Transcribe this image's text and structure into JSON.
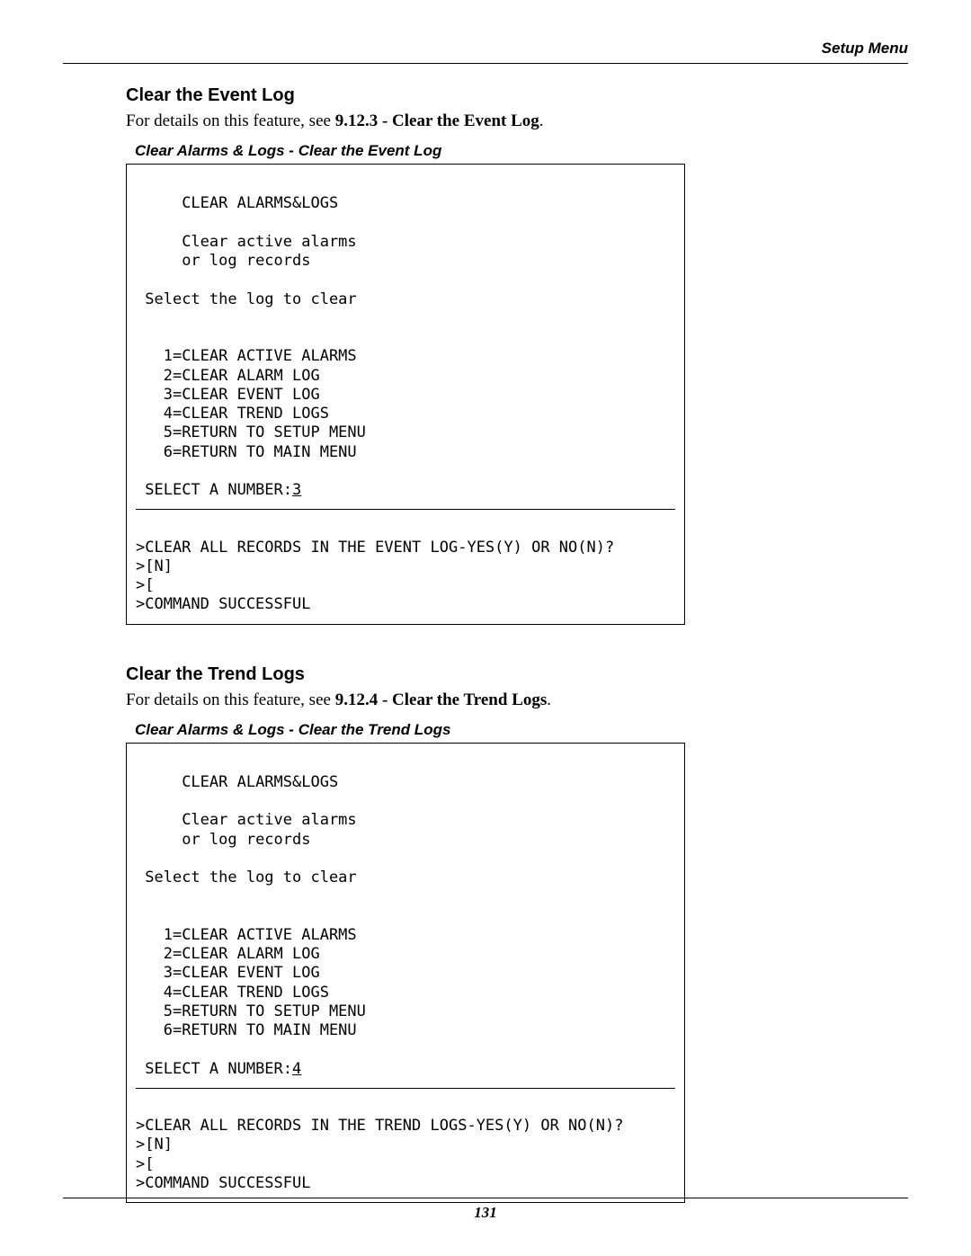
{
  "header": {
    "label": "Setup Menu"
  },
  "page_number": "131",
  "sections": [
    {
      "heading": "Clear the Event Log",
      "lead_pre": "For details on this feature, see ",
      "lead_bold": "9.12.3 - Clear the Event Log",
      "lead_post": ".",
      "caption": "Clear Alarms & Logs - Clear the Event Log",
      "panel": {
        "title": "CLEAR ALARMS&LOGS",
        "sub1": "Clear active alarms",
        "sub2": "or log records",
        "prompt_select": "Select the log to clear",
        "options": [
          "1=CLEAR ACTIVE ALARMS",
          "2=CLEAR ALARM LOG",
          "3=CLEAR EVENT LOG",
          "4=CLEAR TREND LOGS",
          "5=RETURN TO SETUP MENU",
          "6=RETURN TO MAIN MENU"
        ],
        "select_label": "SELECT A NUMBER:",
        "select_value": "3",
        "confirm": ">CLEAR ALL RECORDS IN THE EVENT LOG-YES(Y) OR NO(N)?",
        "resp1": ">[N]",
        "resp2": ">[",
        "result": ">COMMAND SUCCESSFUL"
      }
    },
    {
      "heading": "Clear the Trend Logs",
      "lead_pre": "For details on this feature, see ",
      "lead_bold": "9.12.4 - Clear the Trend Logs",
      "lead_post": ".",
      "caption": "Clear Alarms & Logs - Clear the Trend Logs",
      "panel": {
        "title": "CLEAR ALARMS&LOGS",
        "sub1": "Clear active alarms",
        "sub2": "or log records",
        "prompt_select": "Select the log to clear",
        "options": [
          "1=CLEAR ACTIVE ALARMS",
          "2=CLEAR ALARM LOG",
          "3=CLEAR EVENT LOG",
          "4=CLEAR TREND LOGS",
          "5=RETURN TO SETUP MENU",
          "6=RETURN TO MAIN MENU"
        ],
        "select_label": "SELECT A NUMBER:",
        "select_value": "4",
        "confirm": ">CLEAR ALL RECORDS IN THE TREND LOGS-YES(Y) OR NO(N)?",
        "resp1": ">[N]",
        "resp2": ">[",
        "result": ">COMMAND SUCCESSFUL"
      }
    }
  ]
}
